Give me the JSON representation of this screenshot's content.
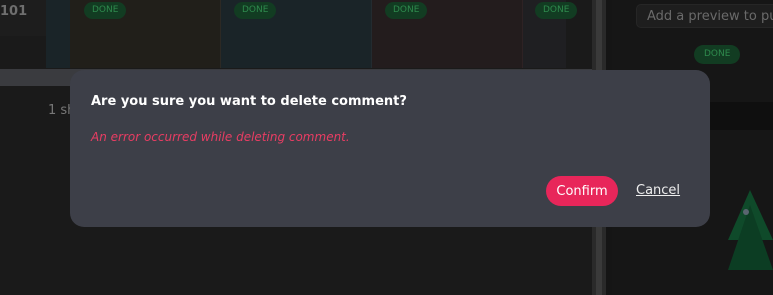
{
  "background": {
    "row_id": "101",
    "status_badges": [
      "DONE",
      "DONE",
      "DONE",
      "DONE"
    ],
    "showing_text": "1 sh",
    "preview_placeholder": "Add a preview to pu",
    "panel_badge": "DONE"
  },
  "modal": {
    "title": "Are you sure you want to delete comment?",
    "error": "An error occurred while deleting comment.",
    "confirm_label": "Confirm",
    "cancel_label": "Cancel"
  },
  "colors": {
    "modal_bg": "#3d3f48",
    "confirm_bg": "#e8265a",
    "error_text": "#e83d63",
    "badge_bg": "#123c22",
    "badge_text": "#2e8a4d"
  }
}
